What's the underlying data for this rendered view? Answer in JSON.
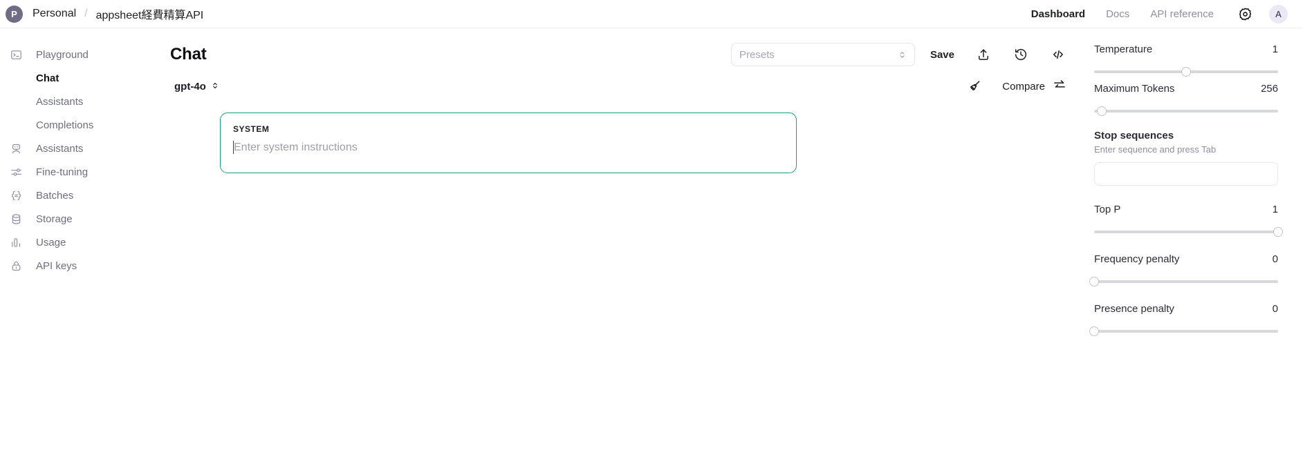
{
  "topbar": {
    "org_initial": "P",
    "org_name": "Personal",
    "separator": "/",
    "project_name": "appsheet経費精算API",
    "nav": [
      {
        "label": "Dashboard",
        "active": true
      },
      {
        "label": "Docs",
        "active": false
      },
      {
        "label": "API reference",
        "active": false
      }
    ],
    "settings_icon": "gear-icon",
    "user_initial": "A"
  },
  "sidebar": {
    "items": [
      {
        "label": "Playground",
        "icon": "terminal-icon",
        "type": "parent",
        "selected": false
      },
      {
        "label": "Chat",
        "type": "sub",
        "selected": true
      },
      {
        "label": "Assistants",
        "type": "sub",
        "selected": false
      },
      {
        "label": "Completions",
        "type": "sub",
        "selected": false
      },
      {
        "label": "Assistants",
        "icon": "robot-icon",
        "type": "parent",
        "selected": false
      },
      {
        "label": "Fine-tuning",
        "icon": "sliders-icon",
        "type": "parent",
        "selected": false
      },
      {
        "label": "Batches",
        "icon": "braces-icon",
        "type": "parent",
        "selected": false
      },
      {
        "label": "Storage",
        "icon": "database-icon",
        "type": "parent",
        "selected": false
      },
      {
        "label": "Usage",
        "icon": "bar-chart-icon",
        "type": "parent",
        "selected": false
      },
      {
        "label": "API keys",
        "icon": "lock-icon",
        "type": "parent",
        "selected": false
      }
    ]
  },
  "main": {
    "title": "Chat",
    "presets_placeholder": "Presets",
    "save_label": "Save",
    "toolbar_icons": [
      "share-icon",
      "history-icon",
      "code-icon"
    ],
    "model": "gpt-4o",
    "clear_icon": "broom-icon",
    "compare_label": "Compare",
    "compare_icon": "swap-arrows-icon",
    "system": {
      "role_label": "SYSTEM",
      "placeholder": "Enter system instructions",
      "focus_color": "#10a37f"
    }
  },
  "params": {
    "temperature": {
      "label": "Temperature",
      "value": "1",
      "pct": 50
    },
    "maximum_tokens": {
      "label": "Maximum Tokens",
      "value": "256",
      "pct": 4
    },
    "stop_sequences": {
      "label": "Stop sequences",
      "hint": "Enter sequence and press Tab",
      "value": ""
    },
    "top_p": {
      "label": "Top P",
      "value": "1",
      "pct": 100
    },
    "frequency_penalty": {
      "label": "Frequency penalty",
      "value": "0",
      "pct": 0
    },
    "presence_penalty": {
      "label": "Presence penalty",
      "value": "0",
      "pct": 0
    }
  }
}
